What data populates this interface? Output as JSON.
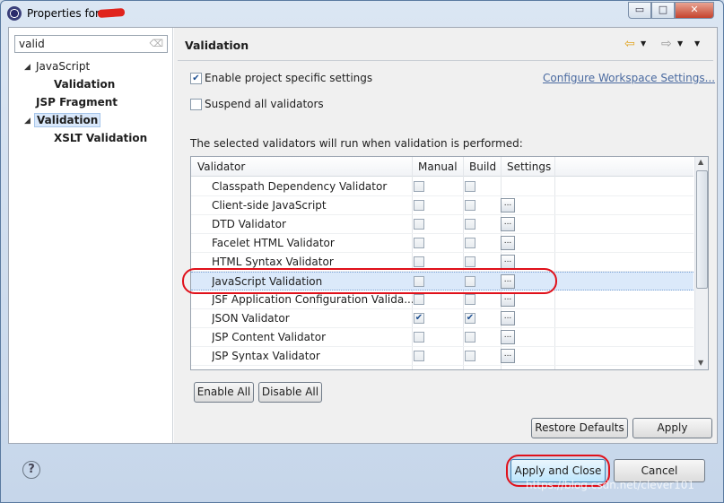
{
  "window": {
    "title": "Properties for",
    "min_glyph": "▭",
    "max_glyph": "□",
    "close_glyph": "✕"
  },
  "sidebar": {
    "filter_value": "valid",
    "tree": [
      {
        "label": "JavaScript",
        "level": 1,
        "expanded": true,
        "bold": false
      },
      {
        "label": "Validation",
        "level": 2,
        "bold": true
      },
      {
        "label": "JSP Fragment",
        "level": 1,
        "bold": true
      },
      {
        "label": "Validation",
        "level": 1,
        "expanded": true,
        "bold": true,
        "selected": true
      },
      {
        "label": "XSLT Validation",
        "level": 2,
        "bold": true
      }
    ]
  },
  "page": {
    "title": "Validation",
    "enable_project_label": "Enable project specific settings",
    "enable_project_checked": true,
    "configure_link": "Configure Workspace Settings...",
    "suspend_label": "Suspend all validators",
    "suspend_checked": false,
    "description": "The selected validators will run when validation is performed:"
  },
  "table": {
    "columns": [
      "Validator",
      "Manual",
      "Build",
      "Settings"
    ],
    "rows": [
      {
        "name": "Classpath Dependency Validator",
        "manual": false,
        "build": false,
        "settings": false
      },
      {
        "name": "Client-side JavaScript",
        "manual": false,
        "build": false,
        "settings": true
      },
      {
        "name": "DTD Validator",
        "manual": false,
        "build": false,
        "settings": true
      },
      {
        "name": "Facelet HTML Validator",
        "manual": false,
        "build": false,
        "settings": true
      },
      {
        "name": "HTML Syntax Validator",
        "manual": false,
        "build": false,
        "settings": true
      },
      {
        "name": "JavaScript Validation",
        "manual": false,
        "build": false,
        "settings": true,
        "selected": true
      },
      {
        "name": "JSF Application Configuration Valida...",
        "manual": false,
        "build": false,
        "settings": true
      },
      {
        "name": "JSON Validator",
        "manual": true,
        "build": true,
        "settings": true
      },
      {
        "name": "JSP Content Validator",
        "manual": false,
        "build": false,
        "settings": true
      },
      {
        "name": "JSP Syntax Validator",
        "manual": false,
        "build": false,
        "settings": true
      }
    ],
    "settings_glyph": "..."
  },
  "buttons": {
    "enable_all": "Enable All",
    "disable_all": "Disable All",
    "restore_defaults": "Restore Defaults",
    "apply": "Apply",
    "apply_and_close": "Apply and Close",
    "cancel": "Cancel"
  },
  "footer": {
    "help_glyph": "?",
    "watermark": "https://blog.csdn.net/clever101"
  },
  "colors": {
    "highlight_ring": "#e0101a",
    "primary_button": "#bee6fd",
    "selection": "#dbe9fa"
  }
}
